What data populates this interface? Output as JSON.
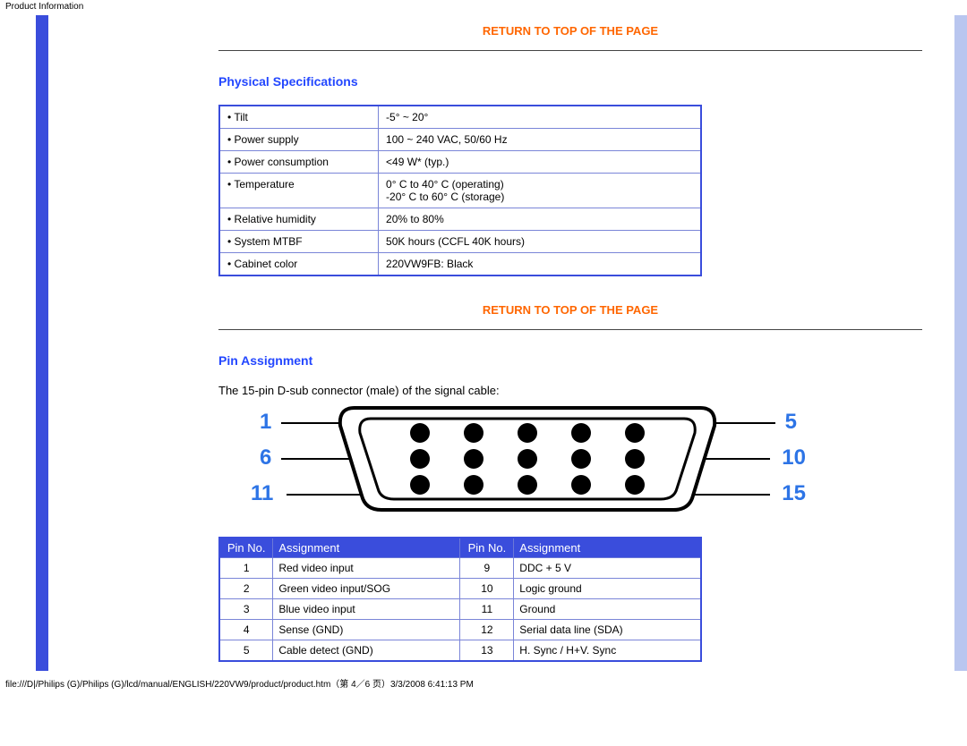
{
  "header": {
    "title": "Product Information"
  },
  "links": {
    "return_top": "RETURN TO TOP OF THE PAGE"
  },
  "sections": {
    "physical_title": "Physical Specifications",
    "pin_title": "Pin Assignment",
    "pin_desc": "The 15-pin D-sub connector (male) of the signal cable:"
  },
  "spec_rows": [
    {
      "label": "• Tilt",
      "value": "-5° ~ 20°"
    },
    {
      "label": "• Power supply",
      "value": "100 ~ 240 VAC, 50/60 Hz"
    },
    {
      "label": "• Power consumption",
      "value": "<49 W* (typ.)"
    },
    {
      "label": "• Temperature",
      "value": "0° C to 40° C (operating)\n-20° C to 60° C (storage)"
    },
    {
      "label": "• Relative humidity",
      "value": "20% to 80%"
    },
    {
      "label": "• System MTBF",
      "value": "50K hours (CCFL 40K hours)"
    },
    {
      "label": "• Cabinet color",
      "value": "220VW9FB: Black"
    }
  ],
  "conn_labels": {
    "l1": "1",
    "l2": "6",
    "l3": "11",
    "r1": "5",
    "r2": "10",
    "r3": "15"
  },
  "pin_headers": {
    "pin_no": "Pin No.",
    "assignment": "Assignment"
  },
  "pin_rows": [
    {
      "a_no": "1",
      "a_assign": "Red video input",
      "b_no": "9",
      "b_assign": "DDC + 5 V"
    },
    {
      "a_no": "2",
      "a_assign": "Green video input/SOG",
      "b_no": "10",
      "b_assign": "Logic ground"
    },
    {
      "a_no": "3",
      "a_assign": "Blue video input",
      "b_no": "11",
      "b_assign": "Ground"
    },
    {
      "a_no": "4",
      "a_assign": "Sense (GND)",
      "b_no": "12",
      "b_assign": "Serial data line (SDA)"
    },
    {
      "a_no": "5",
      "a_assign": "Cable detect (GND)",
      "b_no": "13",
      "b_assign": "H. Sync / H+V. Sync"
    }
  ],
  "footer": {
    "path": "file:///D|/Philips (G)/Philips (G)/lcd/manual/ENGLISH/220VW9/product/product.htm（第 4／6 页）3/3/2008 6:41:13 PM"
  }
}
